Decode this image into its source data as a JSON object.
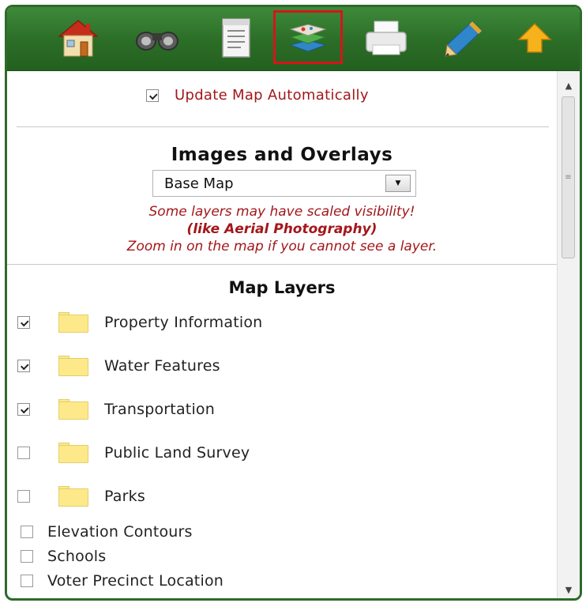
{
  "toolbar": {
    "tools": [
      {
        "icon": "home-icon",
        "label": ""
      },
      {
        "icon": "binoculars-icon",
        "label": ""
      },
      {
        "icon": "document-icon",
        "label": ""
      },
      {
        "icon": "layers-icon",
        "label": "",
        "active": true
      },
      {
        "icon": "printer-icon",
        "label": ""
      },
      {
        "icon": "pencil-icon",
        "label": ""
      },
      {
        "icon": "up-arrow-icon",
        "label": ""
      }
    ]
  },
  "update": {
    "label": "Update Map Automatically",
    "checked": true
  },
  "images": {
    "title": "Images and Overlays",
    "selected": "Base Map",
    "note_line1": "Some layers may have scaled visibility!",
    "note_line2": "(like Aerial Photography)",
    "note_line3": "Zoom in on the map if you cannot see a layer."
  },
  "layers": {
    "title": "Map Layers",
    "groups": [
      {
        "label": "Property Information",
        "checked": true
      },
      {
        "label": "Water Features",
        "checked": true
      },
      {
        "label": "Transportation",
        "checked": true
      },
      {
        "label": "Public Land Survey",
        "checked": false
      },
      {
        "label": "Parks",
        "checked": false
      }
    ],
    "items": [
      {
        "label": "Elevation Contours",
        "checked": false
      },
      {
        "label": "Schools",
        "checked": false
      },
      {
        "label": "Voter Precinct Location",
        "checked": false
      }
    ]
  },
  "colors": {
    "toolbar_green": "#2b6d27",
    "accent_red": "#a3171b",
    "active_border": "#d4161b"
  }
}
